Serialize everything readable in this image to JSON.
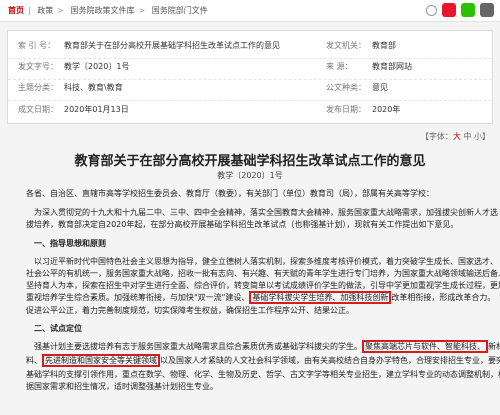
{
  "breadcrumb": {
    "home": "首页",
    "items": [
      "政策",
      "国务院政策文件库",
      "国务院部门文件"
    ]
  },
  "meta": {
    "index_label": "索 引 号：",
    "index_value": "教育部关于在部分高校开展基础学科招生改革试点工作的意见",
    "issuer_label": "发文机关：",
    "issuer_value": "教育部",
    "docno_label": "发文字号：",
    "docno_value": "教学〔2020〕1号",
    "source_label": "来 源：",
    "source_value": "教育部网站",
    "category_label": "主题分类：",
    "category_value": "科技、教育\\教育",
    "type_label": "公文种类：",
    "type_value": "意见",
    "date_label": "成文日期：",
    "date_value": "2020年01月13日",
    "pubdate_label": "发布日期：",
    "pubdate_value": "2020年"
  },
  "font_size_control": {
    "label": "【字体：",
    "large": "大",
    "medium": "中",
    "small": "小",
    "end": "】"
  },
  "article": {
    "title": "教育部关于在部分高校开展基础学科招生改革试点工作的意见",
    "doc_number": "教学〔2020〕1号",
    "salutation": "各省、自治区、直辖市高等学校招生委员会、教育厅（教委），有关部门（单位）教育司（局），部属有关高等学校：",
    "intro_1": "为深入贯彻党的十九大和十九届二中、三中、四中全会精神，落实全国教育大会精神，服务国家重大战略需求，加强拔尖创新人才选",
    "intro_2": "拔培养，教育部决定自2020年起，在部分高校开展基础学科招生改革试点（也称强基计划），现就有关工作提出如下意见。",
    "section_1": "一、指导思想和原则",
    "s1_1": "以习近平新时代中国特色社会主义思想为指导，健全立德树人落实机制，探索多维度考核评价模式，着力突破学生成长、国家选才、",
    "s1_2": "社会公平的有机统一，服务国家重大战略，招收一批有志向、有兴趣、有天赋的青年学生进行专门培养，为国家重大战略领域输送后备人才。",
    "s1_3": "坚持育人为本，探索在招生中对学生进行全面、综合评价，转变简单以考试成绩评价学生的做法，引导中学更加重视学生成长过程，更加",
    "s1_4": "重视培养学生综合素质。加强统筹衔接，与加快\"双一流\"建设、",
    "s1_4_hl": "基础学科拔尖学生培养、加强科技创新",
    "s1_4_end": "改革相衔接，形成改革合力。",
    "s1_5": "促进公平公正，着力完善制度规范，切实保障考生权益，确保招生工作程序公开、结果公正。",
    "section_2": "二、试点定位",
    "s2_1": "强基计划主要选拔培养有志于服务国家重大战略需求且综合素质优秀或基础学科拔尖的学生。",
    "s2_1_hl": "聚焦高端芯片与软件、智能科技、",
    "s2_1_end": "新材",
    "s2_2_a": "料、",
    "s2_2_hl": "先进制造和国家安全等关键领域",
    "s2_2_end": "以及国家人才紧缺的人文社会科学领域，由有关高校结合自身办学特色，合理安排招生专业，要突出",
    "s2_3": "基础学科的支撑引领作用，重点在数学、物理、化学、生物及历史、哲学、古文字学等相关专业招生，建立学科专业的动态调整机制，根",
    "s2_4": "据国家需求和招生情况，适时调整强基计划招生专业。"
  }
}
